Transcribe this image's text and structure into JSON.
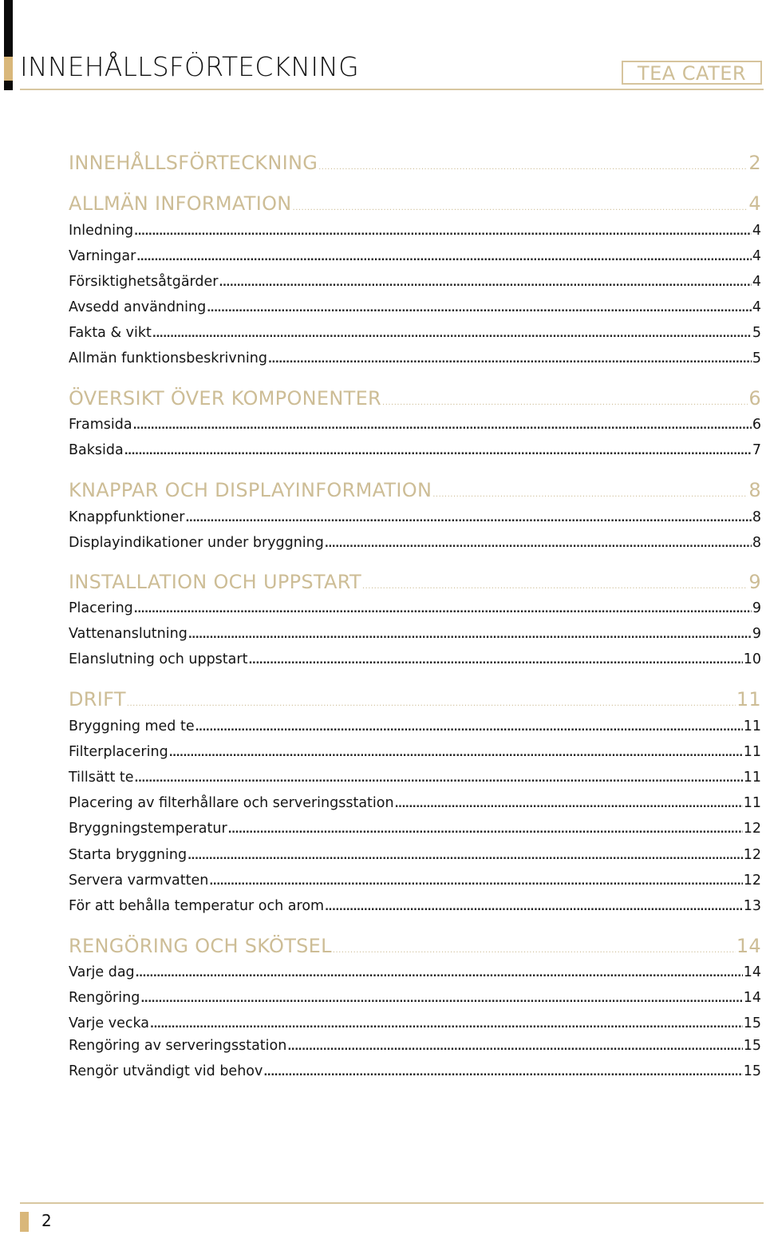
{
  "header": {
    "title": "INNEHÅLLSFÖRTECKNING",
    "brand": "TEA CATER"
  },
  "colors": {
    "accent_gold": "#d9b77a",
    "section_text": "#cdbd96",
    "rule": "#d8c7a0",
    "body_text": "#141414"
  },
  "toc": [
    {
      "type": "section",
      "label": "INNEHÅLLSFÖRTECKNING",
      "page": "2"
    },
    {
      "type": "section",
      "label": "ALLMÄN INFORMATION",
      "page": "4"
    },
    {
      "type": "entry",
      "label": "Inledning",
      "page": "4"
    },
    {
      "type": "entry",
      "label": "Varningar",
      "page": "4"
    },
    {
      "type": "entry",
      "label": "Försiktighetsåtgärder",
      "page": "4"
    },
    {
      "type": "entry",
      "label": "Avsedd användning",
      "page": "4"
    },
    {
      "type": "entry",
      "label": "Fakta & vikt",
      "page": "5"
    },
    {
      "type": "entry",
      "label": "Allmän funktionsbeskrivning",
      "page": "5"
    },
    {
      "type": "section",
      "label": "ÖVERSIKT ÖVER KOMPONENTER",
      "page": "6"
    },
    {
      "type": "entry",
      "label": "Framsida",
      "page": "6"
    },
    {
      "type": "entry",
      "label": "Baksida",
      "page": "7"
    },
    {
      "type": "section",
      "label": "KNAPPAR OCH DISPLAYINFORMATION",
      "page": "8"
    },
    {
      "type": "entry",
      "label": "Knappfunktioner",
      "page": "8"
    },
    {
      "type": "entry",
      "label": "Displayindikationer under bryggning",
      "page": "8"
    },
    {
      "type": "section",
      "label": "INSTALLATION OCH UPPSTART",
      "page": "9"
    },
    {
      "type": "entry",
      "label": "Placering",
      "page": "9"
    },
    {
      "type": "entry",
      "label": "Vattenanslutning",
      "page": "9"
    },
    {
      "type": "entry",
      "label": "Elanslutning och uppstart",
      "page": "10"
    },
    {
      "type": "section",
      "label": "DRIFT",
      "page": "11"
    },
    {
      "type": "entry",
      "label": "Bryggning med te",
      "page": "11"
    },
    {
      "type": "entry",
      "label": "Filterplacering",
      "page": "11"
    },
    {
      "type": "entry",
      "label": "Tillsätt te",
      "page": "11"
    },
    {
      "type": "entry",
      "label": "Placering av filterhållare och serveringsstation",
      "page": "11"
    },
    {
      "type": "entry",
      "label": "Bryggningstemperatur",
      "page": "12"
    },
    {
      "type": "entry",
      "label": "Starta bryggning",
      "page": "12"
    },
    {
      "type": "entry",
      "label": "Servera varmvatten",
      "page": "12"
    },
    {
      "type": "entry",
      "label": "För att behålla temperatur och arom",
      "page": "13"
    },
    {
      "type": "section",
      "label": "RENGÖRING OCH SKÖTSEL",
      "page": "14"
    },
    {
      "type": "entry",
      "label": "Varje dag",
      "page": "14"
    },
    {
      "type": "entry",
      "label": "Rengöring",
      "page": "14"
    },
    {
      "type": "entry",
      "label": "Varje vecka",
      "page": "15"
    },
    {
      "type": "entry",
      "label": "Rengöring av serveringsstation",
      "page": "15"
    },
    {
      "type": "entry",
      "label": "Rengör utvändigt vid behov",
      "page": "15"
    }
  ],
  "footer": {
    "page_number": "2"
  }
}
